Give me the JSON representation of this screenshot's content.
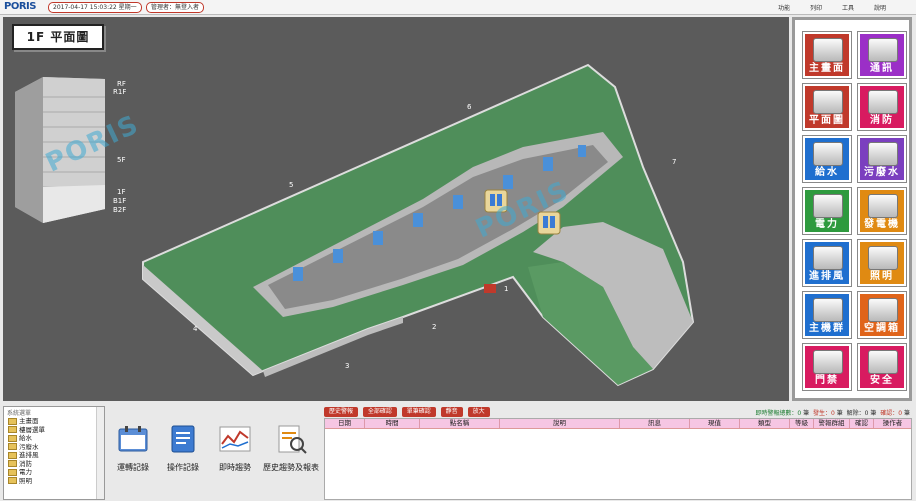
{
  "header": {
    "logo_main": "PORIS",
    "datetime": "2017-04-17 15:03:22 星期一",
    "user": "管理者：無登入者",
    "menu": [
      "功能",
      "列印",
      "工具",
      "說明"
    ]
  },
  "viewport": {
    "floor_title": "1F 平面圖",
    "watermark": "PORIS",
    "building_floors": [
      "RF",
      "R1F",
      "5F",
      "1F",
      "B1F",
      "B2F"
    ],
    "camera_markers": [
      "1",
      "2",
      "3",
      "4",
      "5",
      "6",
      "7"
    ]
  },
  "systems": [
    {
      "label": "主畫面",
      "color": "#c0392b"
    },
    {
      "label": "通訊",
      "color": "#9b2fc7"
    },
    {
      "label": "平面圖",
      "color": "#c0392b"
    },
    {
      "label": "消防",
      "color": "#d81b60"
    },
    {
      "label": "給水",
      "color": "#1f6fcf"
    },
    {
      "label": "污廢水",
      "color": "#7b3fbf"
    },
    {
      "label": "電力",
      "color": "#2e9a3e"
    },
    {
      "label": "發電機",
      "color": "#e08a12"
    },
    {
      "label": "進排風",
      "color": "#1f6fcf"
    },
    {
      "label": "照明",
      "color": "#e08a12"
    },
    {
      "label": "主機群",
      "color": "#1f6fcf"
    },
    {
      "label": "空調箱",
      "color": "#e0641a"
    },
    {
      "label": "門禁",
      "color": "#d81b60"
    },
    {
      "label": "安全",
      "color": "#d81b60"
    }
  ],
  "tree": {
    "title": "系統選單",
    "items": [
      "主畫面",
      "樓層選單",
      "給水",
      "污廢水",
      "進排風",
      "消防",
      "電力",
      "照明"
    ]
  },
  "tools": [
    "運轉記錄",
    "操作記錄",
    "即時趨勢",
    "歷史趨勢及報表"
  ],
  "alarm": {
    "buttons": [
      "歷史警報",
      "全部確認",
      "單筆確認",
      "靜音",
      "放大"
    ],
    "counts": {
      "label_active": "即時警報總數：",
      "active": "0",
      "unit": "筆",
      "label_occur": "發生：",
      "occur": "0",
      "label_clear": "解除：",
      "clear": "0",
      "label_confirm": "確認：",
      "confirm": "0"
    },
    "columns": [
      "日期",
      "時間",
      "點名稱",
      "說明",
      "訊息",
      "現值",
      "類型",
      "等級",
      "警報群組",
      "確認",
      "操作者"
    ]
  }
}
